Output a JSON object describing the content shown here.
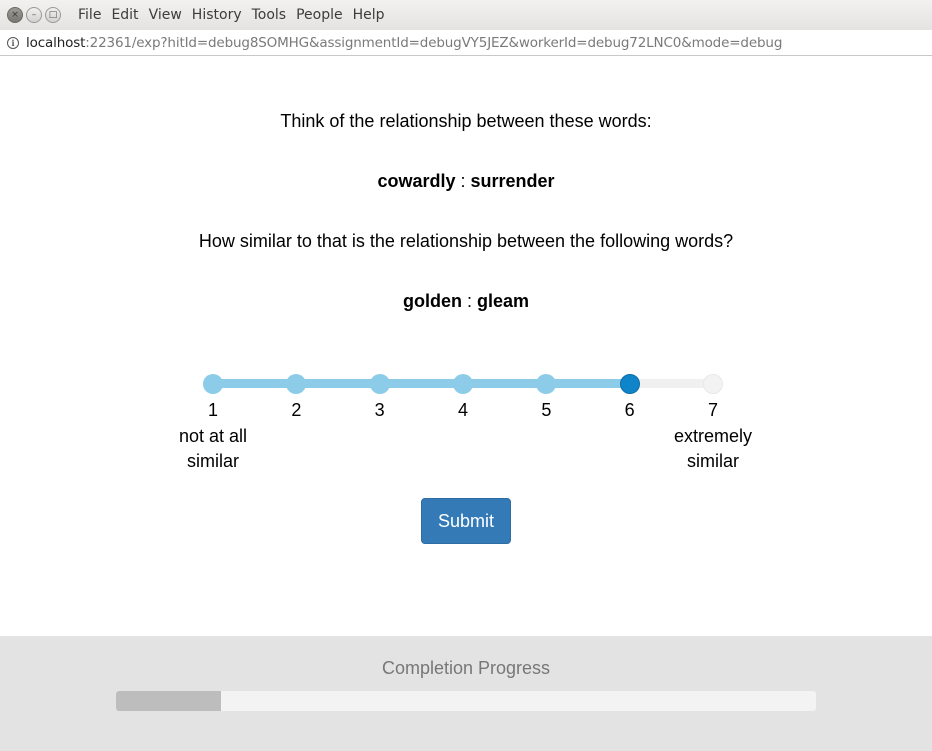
{
  "window": {
    "menu": [
      "File",
      "Edit",
      "View",
      "History",
      "Tools",
      "People",
      "Help"
    ],
    "buttons": {
      "close": "×",
      "minimize": "–",
      "maximize": "□"
    }
  },
  "urlbar": {
    "host": "localhost",
    "rest": ":22361/exp?hitId=debug8SOMHG&assignmentId=debugVY5JEZ&workerId=debug72LNC0&mode=debug",
    "info_icon": "i"
  },
  "task": {
    "prompt": "Think of the relationship between these words:",
    "pair1": {
      "a": "cowardly",
      "sep": ":",
      "b": "surrender"
    },
    "question": "How similar to that is the relationship between the following words?",
    "pair2": {
      "a": "golden",
      "sep": ":",
      "b": "gleam"
    }
  },
  "scale": {
    "ticks": [
      "1",
      "2",
      "3",
      "4",
      "5",
      "6",
      "7"
    ],
    "selected": 6,
    "low_label": {
      "line1": "not at all",
      "line2": "similar"
    },
    "high_label": {
      "line1": "extremely",
      "line2": "similar"
    },
    "colors": {
      "fill": "#8ccce9",
      "handle": "#0f84c8",
      "empty": "#f0f0f0"
    }
  },
  "submit_label": "Submit",
  "footer": {
    "title": "Completion Progress",
    "progress_fraction": 0.15
  }
}
